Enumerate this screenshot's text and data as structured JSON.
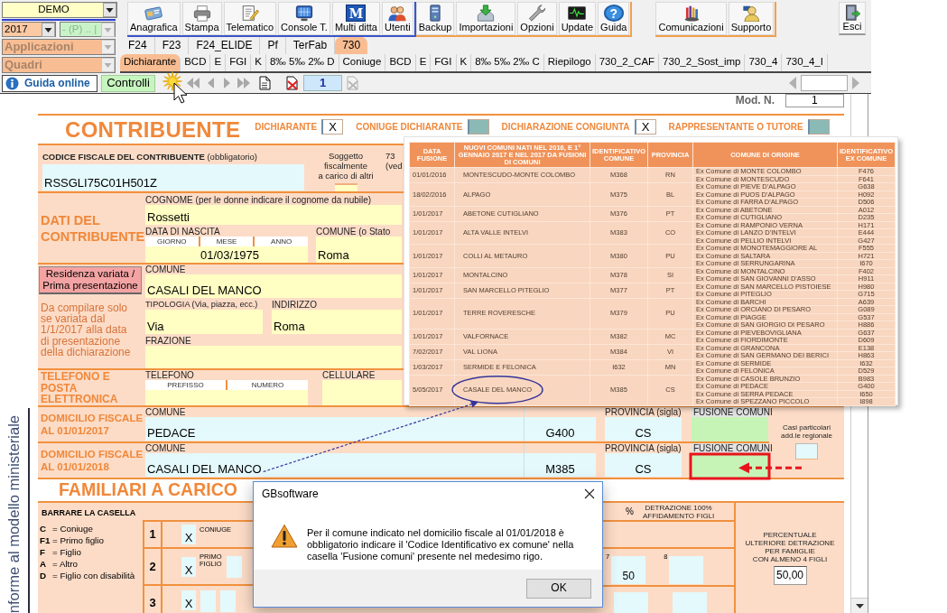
{
  "selectors": {
    "company": "DEMO",
    "year": "2017",
    "mode": "- (P) .. |",
    "applications": "Applicazioni",
    "sections": "Quadri"
  },
  "toolbar_groups": [
    {
      "color": "#3a55c8",
      "buttons": [
        {
          "label": "Anagrafica"
        },
        {
          "label": "Stampa"
        },
        {
          "label": "Telematico"
        },
        {
          "label": "Console T."
        },
        {
          "label": "Multi ditta",
          "glyph": "M"
        },
        {
          "label": "Utenti"
        }
      ]
    },
    {
      "color": "#f2a04e",
      "buttons": [
        {
          "label": "Backup"
        },
        {
          "label": "Importazioni"
        },
        {
          "label": "Opzioni"
        },
        {
          "label": "Update"
        },
        {
          "label": "Guida",
          "glyph": "?"
        }
      ]
    },
    {
      "color": "#f2a04e",
      "buttons": [
        {
          "label": "Comunicazioni"
        },
        {
          "label": "Supporto"
        }
      ]
    }
  ],
  "exit_button": "Esci",
  "app_tabs": [
    {
      "label": "F24",
      "selected": false
    },
    {
      "label": "F23",
      "selected": false
    },
    {
      "label": "F24_ELIDE",
      "selected": false
    },
    {
      "label": "Pf",
      "selected": false
    },
    {
      "label": "TerFab",
      "selected": false
    },
    {
      "label": "730",
      "selected": true
    }
  ],
  "form_tabs": [
    {
      "label": "Dichiarante",
      "selected": true
    },
    {
      "label": "BCD",
      "selected": false
    },
    {
      "label": "E",
      "selected": false
    },
    {
      "label": "FGI",
      "selected": false
    },
    {
      "label": "K",
      "selected": false
    },
    {
      "label": "8‰ 5‰ 2‰ D",
      "selected": false
    },
    {
      "label": "Coniuge",
      "selected": false
    },
    {
      "label": "BCD",
      "selected": false
    },
    {
      "label": "E",
      "selected": false
    },
    {
      "label": "FGI",
      "selected": false
    },
    {
      "label": "K",
      "selected": false
    },
    {
      "label": "8‰ 5‰ 2‰ C",
      "selected": false
    },
    {
      "label": "Riepilogo",
      "selected": false
    },
    {
      "label": "730_2_CAF",
      "selected": false
    },
    {
      "label": "730_2_Sost_imp",
      "selected": false
    },
    {
      "label": "730_4",
      "selected": false
    },
    {
      "label": "730_4_I",
      "selected": false
    }
  ],
  "navigation": {
    "help": "Guida online",
    "checks": "Controlli",
    "page": "1"
  },
  "form": {
    "model_label": "Mod. N.",
    "model_number": "1",
    "title": "CONTRIBUENTE",
    "declarant_flags": [
      {
        "label": "DICHIARANTE",
        "checked": true,
        "value": "X"
      },
      {
        "label": "CONIUGE DICHIARANTE",
        "checked": false
      },
      {
        "label": "DICHIARAZIONE CONGIUNTA",
        "checked": true,
        "value": "X"
      },
      {
        "label": "RAPPRESENTANTE O TUTORE",
        "checked": false
      }
    ],
    "tax_code": {
      "label": "**CODICE FISCALE DEL CONTRIBUENTE** (obbligatorio)",
      "value": "RSSGLI75C01H501Z"
    },
    "dependent": {
      "label": "Soggetto fiscalmente\na carico di altri",
      "note": "73\n(ved"
    },
    "personal": {
      "title": "DATI DEL\nCONTRIBUENTE",
      "surname_label": "COGNOME (per le donne indicare il cognome da nubile)",
      "surname": "Rossetti",
      "birth_label": "DATA DI NASCITA",
      "birth_parts": [
        "GIORNO",
        "MESE",
        "ANNO"
      ],
      "birth_date": "01/03/1975",
      "town_label": "COMUNE (o Stato",
      "town": "Roma"
    },
    "residence": {
      "button": "Residenza variata /\nPrima presentazione",
      "note": "Da compilare solo\nse variata dal\n1/1/2017 alla data\ndi presentazione\ndella dichiarazione",
      "town_label": "COMUNE",
      "town": "CASALI DEL MANCO",
      "type_label": "TIPOLOGIA (Via, piazza, ecc.)",
      "type": "Via",
      "address_label": "INDIRIZZO",
      "address": "Roma",
      "hamlet_label": "FRAZIONE"
    },
    "contacts": {
      "title": "TELEFONO E\nPOSTA\nELETTRONICA",
      "phone_label": "TELEFONO",
      "phone_parts": [
        "PREFISSO",
        "NUMERO"
      ],
      "mobile_label": "CELLULARE"
    },
    "tax_domiciles": [
      {
        "title": "DOMICILIO FISCALE\nAL 01/01/2017",
        "town_label": "COMUNE",
        "town": "PEDACE",
        "code": "G400",
        "province_label": "PROVINCIA (sigla)",
        "province": "CS",
        "merger_label": "FUSIONE COMUNI",
        "highlighted": false
      },
      {
        "title": "DOMICILIO FISCALE\nAL 01/01/2018",
        "town_label": "COMUNE",
        "town": "CASALI DEL MANCO",
        "code": "M385",
        "province_label": "PROVINCIA (sigla)",
        "province": "CS",
        "merger_label": "FUSIONE COMUNI",
        "highlighted": true
      }
    ],
    "special_cases": {
      "label": "Casi particolari\nadd.le regionale"
    },
    "dependents_title": "FAMILIARI A CARICO",
    "dependents": {
      "instruction": "BARRARE LA CASELLA",
      "legend": [
        {
          "code": "C",
          "meaning": "= Coniuge"
        },
        {
          "code": "F1",
          "meaning": "= Primo figlio"
        },
        {
          "code": "F",
          "meaning": "= Figlio"
        },
        {
          "code": "A",
          "meaning": "= Altro"
        },
        {
          "code": "D",
          "meaning": "= Figlio con disabilità"
        }
      ],
      "rows": [
        {
          "number": "1",
          "kind": "spouse",
          "checked": true,
          "mark": "X",
          "label": "CONIUGE"
        },
        {
          "number": "2",
          "kind": "first_child",
          "checked": true,
          "mark": "X",
          "label": "PRIMO\nFIGLIO"
        },
        {
          "number": "3",
          "kind": "child",
          "checked": true,
          "mark": "X"
        }
      ],
      "percent_label": "%",
      "custody_label": "DETRAZIONE 100%\nAFFIDAMENTO FIGLI",
      "fields": [
        {
          "index": "7",
          "value": "50"
        },
        {
          "index": "8"
        }
      ],
      "extra_label": "PERCENTUALE\nULTERIORE DETRAZIONE\nPER FAMIGLIE\nCON ALMENO 4 FIGLI",
      "extra_value": "50,00"
    }
  },
  "side_note": "nforme al modello ministeriale",
  "fusion_table": {
    "columns": [
      "DATA FUSIONE",
      "NUOVI COMUNI NATI NEL 2016, E 1° GENNAIO 2017 E NEL 2017 DA FUSIONI DI COMUNI",
      "IDENTIFICATIVO COMUNE",
      "PROVINCIA",
      "COMUNE DI ORIGINE",
      "IDENTIFICATIVO EX COMUNE"
    ],
    "rows": [
      {
        "date": "01/01/2016",
        "name": "MONTESCUDO-MONTE COLOMBO",
        "code": "M368",
        "province": "RN",
        "circled": false,
        "origins": [
          {
            "name": "Ex Comune di MONTE COLOMBO",
            "code": "F476"
          },
          {
            "name": "Ex Comune di MONTESCUDO",
            "code": "F641"
          }
        ]
      },
      {
        "date": "18/02/2016",
        "name": "ALPAGO",
        "code": "M375",
        "province": "BL",
        "circled": false,
        "origins": [
          {
            "name": "Ex Comune di PIEVE D'ALPAGO",
            "code": "G638"
          },
          {
            "name": "Ex Comune di PUOS D'ALPAGO",
            "code": "H092"
          },
          {
            "name": "Ex Comune di FARRA D'ALPAGO",
            "code": "D506"
          }
        ]
      },
      {
        "date": "1/01/2017",
        "name": "ABETONE CUTIGLIANO",
        "code": "M376",
        "province": "PT",
        "circled": false,
        "origins": [
          {
            "name": "Ex Comune di ABETONE",
            "code": "A012"
          },
          {
            "name": "Ex Comune di CUTIGLIANO",
            "code": "D235"
          }
        ]
      },
      {
        "date": "1/01/2017",
        "name": "ALTA VALLE INTELVI",
        "code": "M383",
        "province": "CO",
        "circled": false,
        "origins": [
          {
            "name": "Ex Comune di RAMPONIO VERNA",
            "code": "H171"
          },
          {
            "name": "Ex Comune di LANZO D'INTELVI",
            "code": "E444"
          },
          {
            "name": "Ex Comune di PELLIO INTELVI",
            "code": "G427"
          }
        ]
      },
      {
        "date": "1/01/2017",
        "name": "COLLI AL METAURO",
        "code": "M380",
        "province": "PU",
        "circled": false,
        "origins": [
          {
            "name": "Ex Comune di MONOTEMAGGIORE AL",
            "code": "F555"
          },
          {
            "name": "Ex Comune di SALTARA",
            "code": "H721"
          },
          {
            "name": "Ex Comune di SERRUNGARINA",
            "code": "I670"
          }
        ]
      },
      {
        "date": "1/01/2017",
        "name": "MONTALCINO",
        "code": "M378",
        "province": "SI",
        "circled": false,
        "origins": [
          {
            "name": "Ex Comune di MONTALCINO",
            "code": "F402"
          },
          {
            "name": "Ex Comune di SAN GIOVANNI D'ASSO",
            "code": "H911"
          }
        ]
      },
      {
        "date": "1/01/2017",
        "name": "SAN MARCELLO PITEGLIO",
        "code": "M377",
        "province": "PT",
        "circled": false,
        "origins": [
          {
            "name": "Ex Comune di SAN MARCELLO PISTOIESE",
            "code": "H980"
          },
          {
            "name": "Ex Comune di PITEGLIO",
            "code": "G715"
          }
        ]
      },
      {
        "date": "1/01/2017",
        "name": "TERRE ROVERESCHE",
        "code": "M379",
        "province": "PU",
        "circled": false,
        "origins": [
          {
            "name": "Ex Comune di BARCHI",
            "code": "A639"
          },
          {
            "name": "Ex Comune di ORCIANO DI PESARO",
            "code": "G089"
          },
          {
            "name": "Ex Comune di PIAGGE",
            "code": "G537"
          },
          {
            "name": "Ex Comune di SAN GIORGIO DI PESARO",
            "code": "H886"
          }
        ]
      },
      {
        "date": "1/01/2017",
        "name": "VALFORNACE",
        "code": "M382",
        "province": "MC",
        "circled": false,
        "origins": [
          {
            "name": "Ex Comune di PIEVEBOVIGLIANA",
            "code": "G637"
          },
          {
            "name": "Ex Comune di FIORDIMONTE",
            "code": "D609"
          }
        ]
      },
      {
        "date": "7/02/2017",
        "name": "VAL LIONA",
        "code": "M384",
        "province": "VI",
        "circled": false,
        "origins": [
          {
            "name": "Ex Comune di GRANCONA",
            "code": "E138"
          },
          {
            "name": "Ex Comune di SAN GERMANO DEI BERICI",
            "code": "H863"
          }
        ]
      },
      {
        "date": "1/03/2017",
        "name": "SERMIDE E FELONICA",
        "code": "I632",
        "province": "MN",
        "circled": false,
        "origins": [
          {
            "name": "Ex Comune di SERMIDE",
            "code": "I632"
          },
          {
            "name": "Ex Comune di FELONICA",
            "code": "D529"
          }
        ]
      },
      {
        "date": "5/05/2017",
        "name": "CASALE DEL MANCO",
        "code": "M385",
        "province": "CS",
        "circled": true,
        "origins": [
          {
            "name": "Ex Comune di CASOLE BRUNZIO",
            "code": "B983"
          },
          {
            "name": "Ex Comune di PEDACE",
            "code": "G400"
          },
          {
            "name": "Ex Comune di SERRA PEDACE",
            "code": "I650"
          },
          {
            "name": "Ex Comune di SPEZZANO PICCOLO",
            "code": "I898"
          }
        ]
      }
    ]
  },
  "dialog": {
    "title": "GBsoftware",
    "message": "Per il comune indicato nel domicilio fiscale al 01/01/2018 è\nobbligatorio indicare il 'Codice Identificativo ex comune' nella\ncasella 'Fusione comuni' presente nel medesimo rigo.",
    "button": "OK"
  }
}
